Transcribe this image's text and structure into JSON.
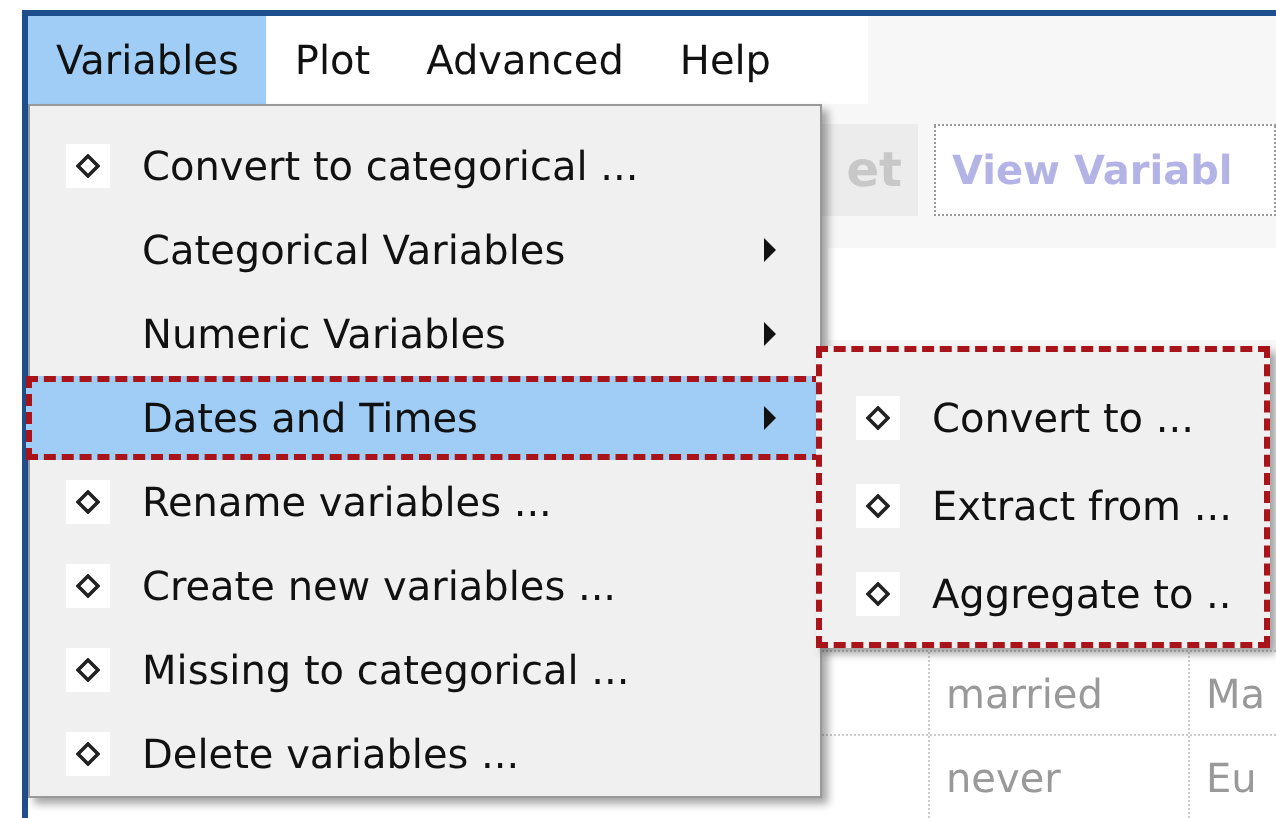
{
  "menubar": [
    {
      "label": "Variables",
      "selected": true
    },
    {
      "label": "Plot",
      "selected": false
    },
    {
      "label": "Advanced",
      "selected": false
    },
    {
      "label": "Help",
      "selected": false
    }
  ],
  "toolbar": [
    "et",
    "View Variabl"
  ],
  "table_rows": [
    [
      "married",
      "Ma"
    ],
    [
      "never",
      "Eu"
    ]
  ],
  "menu": [
    {
      "label": "Convert to categorical ...",
      "kind": "action",
      "selected": false,
      "annotated": false
    },
    {
      "label": "Categorical Variables",
      "kind": "submenu",
      "selected": false,
      "annotated": false
    },
    {
      "label": "Numeric Variables",
      "kind": "submenu",
      "selected": false,
      "annotated": false
    },
    {
      "label": "Dates and Times",
      "kind": "submenu",
      "selected": true,
      "annotated": true
    },
    {
      "label": "Rename variables ...",
      "kind": "action",
      "selected": false,
      "annotated": false
    },
    {
      "label": "Create new variables ...",
      "kind": "action",
      "selected": false,
      "annotated": false
    },
    {
      "label": "Missing to categorical ...",
      "kind": "action",
      "selected": false,
      "annotated": false
    },
    {
      "label": "Delete variables ...",
      "kind": "action",
      "selected": false,
      "annotated": false
    }
  ],
  "submenu": {
    "annotated": true,
    "items": [
      {
        "label": "Convert to ..."
      },
      {
        "label": "Extract from ..."
      },
      {
        "label": "Aggregate to .."
      }
    ]
  }
}
